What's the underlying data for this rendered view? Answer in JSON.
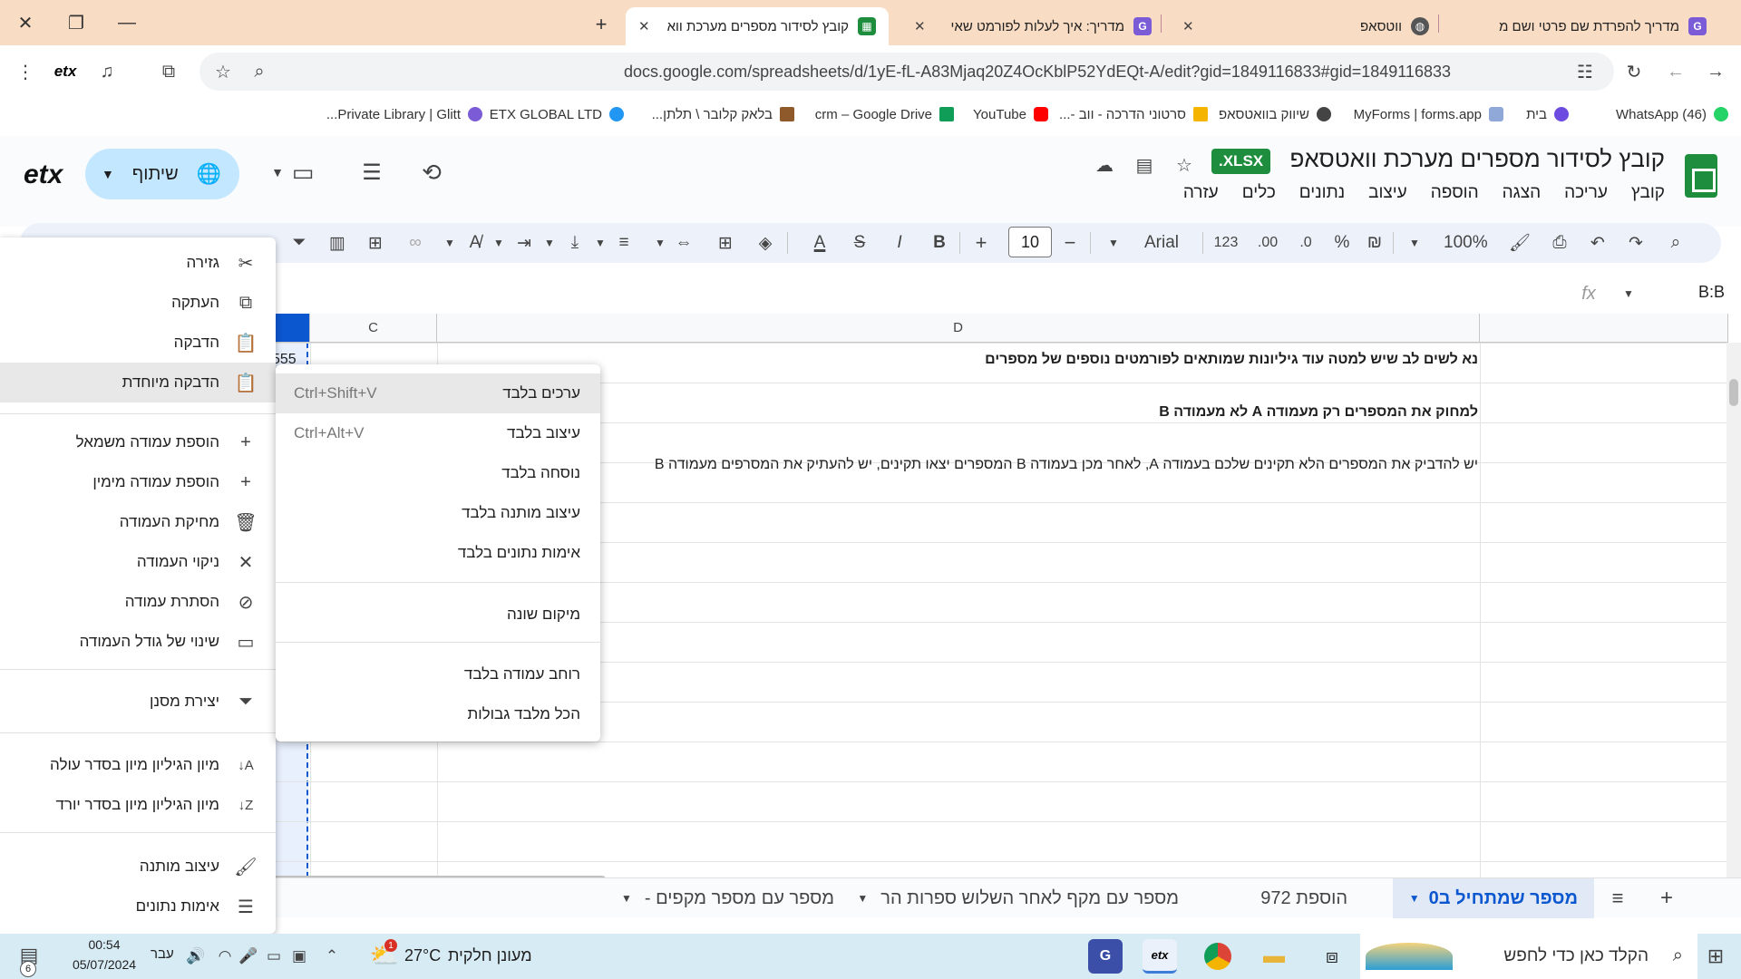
{
  "browser": {
    "tabs": [
      {
        "label": "קובץ לסידור מספרים מערכת ווא",
        "fav_color": "#1e8e3e",
        "active": true
      },
      {
        "label": "מדריך: איך לעלות לפורמט שאי",
        "fav_color": "#7b5cd6",
        "active": false
      },
      {
        "label": "ווטסאפ",
        "fav_color": "#555555",
        "active": false
      },
      {
        "label": "מדריך להפרדת שם פרטי ושם מ",
        "fav_color": "#7b5cd6",
        "active": false
      }
    ],
    "url": "docs.google.com/spreadsheets/d/1yE-fL-A83Mjaq20Z4OcKblP52YdEQt-A/edit?gid=1849116833#gid=1849116833",
    "bookmarks": [
      {
        "label": "(46) WhatsApp",
        "color": "#25d366"
      },
      {
        "label": "בית",
        "color": "#6c4ce0"
      },
      {
        "label": "MyForms | forms.app",
        "color": "#8fa8d8"
      },
      {
        "label": "שיווק בוואטסאפ",
        "color": "#444444"
      },
      {
        "label": "סרטוני הדרכה - ווב -...",
        "color": "#f4b400"
      },
      {
        "label": "YouTube",
        "color": "#ff0000"
      },
      {
        "label": "crm – Google Drive",
        "color": "#0f9d58"
      },
      {
        "label": "בלאק קלובר \\ תלתן...",
        "color": "#8e5a2b"
      },
      {
        "label": "ETX GLOBAL LTD",
        "color": "#2196f3"
      },
      {
        "label": "Private Library | Glitt...",
        "color": "#7b5cd6"
      }
    ]
  },
  "sheets": {
    "doc_title": "קובץ לסידור מספרים מערכת וואטסאפ",
    "badge": ".XLSX",
    "menu": [
      "קובץ",
      "עריכה",
      "הצגה",
      "הוספה",
      "עיצוב",
      "נתונים",
      "כלים",
      "עזרה"
    ],
    "share_label": "שיתוף",
    "brand": "etx",
    "toolbar": {
      "zoom": "100%",
      "currency": "₪",
      "percent": "%",
      "dec_less": ".0",
      "dec_more": ".00",
      "format_num": "123",
      "font": "Arial",
      "font_size": "10"
    },
    "name_box": "B:B",
    "fx": "fx",
    "columns": [
      "C",
      "D"
    ],
    "partial_cell": "555",
    "rows": [
      {
        "text": "נא לשים לב שיש למטה עוד גיליונות שמותאים לפורמטים נוספים של מספרים",
        "bold": true
      },
      {
        "text": "",
        "bold": false
      },
      {
        "text": "למחוק את המספרים רק מעמודה A לא מעמודה B",
        "bold": true
      },
      {
        "text": "",
        "bold": false
      },
      {
        "text": "יש להדביק את המספרים הלא תקינים שלכם בעמודה A, לאחר מכן בעמודה B המספרים יצאו תקינים, יש להעתיק את המסרפים מעמודה B",
        "bold": false
      }
    ],
    "sheet_tabs": [
      {
        "label": "מספר שמתחיל ב0",
        "active": true
      },
      {
        "label": "הוספת 972",
        "active": false
      },
      {
        "label": "מספר עם מקף לאחר השלוש ספרות הר",
        "active": false
      },
      {
        "label": "מספר עם מספר מקפים -",
        "active": false
      }
    ]
  },
  "context_menu": {
    "items": [
      {
        "label": "גזירה",
        "icon": "scissors-icon",
        "glyph": "✂"
      },
      {
        "label": "העתקה",
        "icon": "copy-icon",
        "glyph": "⧉"
      },
      {
        "label": "הדבקה",
        "icon": "paste-icon",
        "glyph": "📋"
      },
      {
        "label": "הדבקה מיוחדת",
        "icon": "paste-special-icon",
        "glyph": "📋"
      },
      {
        "label": "הוספת עמודה משמאל",
        "icon": "plus-icon",
        "glyph": "+"
      },
      {
        "label": "הוספת עמודה מימין",
        "icon": "plus-icon",
        "glyph": "+"
      },
      {
        "label": "מחיקת העמודה",
        "icon": "trash-icon",
        "glyph": "🗑"
      },
      {
        "label": "ניקוי העמודה",
        "icon": "clear-icon",
        "glyph": "✕"
      },
      {
        "label": "הסתרת עמודה",
        "icon": "eye-off-icon",
        "glyph": "⊘"
      },
      {
        "label": "שינוי של גודל העמודה",
        "icon": "resize-icon",
        "glyph": "▭"
      },
      {
        "label": "יצירת מסנן",
        "icon": "filter-icon",
        "glyph": "⏷"
      },
      {
        "label": "מיון הגיליון מיון בסדר עולה",
        "icon": "sort-az-icon",
        "glyph": "A↓"
      },
      {
        "label": "מיון הגיליון מיון בסדר יורד",
        "icon": "sort-za-icon",
        "glyph": "Z↓"
      },
      {
        "label": "עיצוב מותנה",
        "icon": "paint-roller-icon",
        "glyph": "🖌"
      },
      {
        "label": "אימות נתונים",
        "icon": "data-validation-icon",
        "glyph": "☰"
      }
    ]
  },
  "paste_special": {
    "items": [
      {
        "label": "ערכים בלבד",
        "shortcut": "Ctrl+Shift+V"
      },
      {
        "label": "עיצוב בלבד",
        "shortcut": "Ctrl+Alt+V"
      },
      {
        "label": "נוסחה בלבד",
        "shortcut": ""
      },
      {
        "label": "עיצוב מותנה בלבד",
        "shortcut": ""
      },
      {
        "label": "אימות נתונים בלבד",
        "shortcut": ""
      },
      {
        "label": "מיקום שונה",
        "shortcut": ""
      },
      {
        "label": "רוחב עמודה בלבד",
        "shortcut": ""
      },
      {
        "label": "הכל מלבד גבולות",
        "shortcut": ""
      }
    ]
  },
  "taskbar": {
    "search_placeholder": "הקלד כאן כדי לחפש",
    "weather": "מעונן חלקית",
    "temperature": "27°C",
    "lang": "עבר",
    "time": "00:54",
    "date": "05/07/2024",
    "notif_count": "6",
    "weather_badge": "1"
  }
}
